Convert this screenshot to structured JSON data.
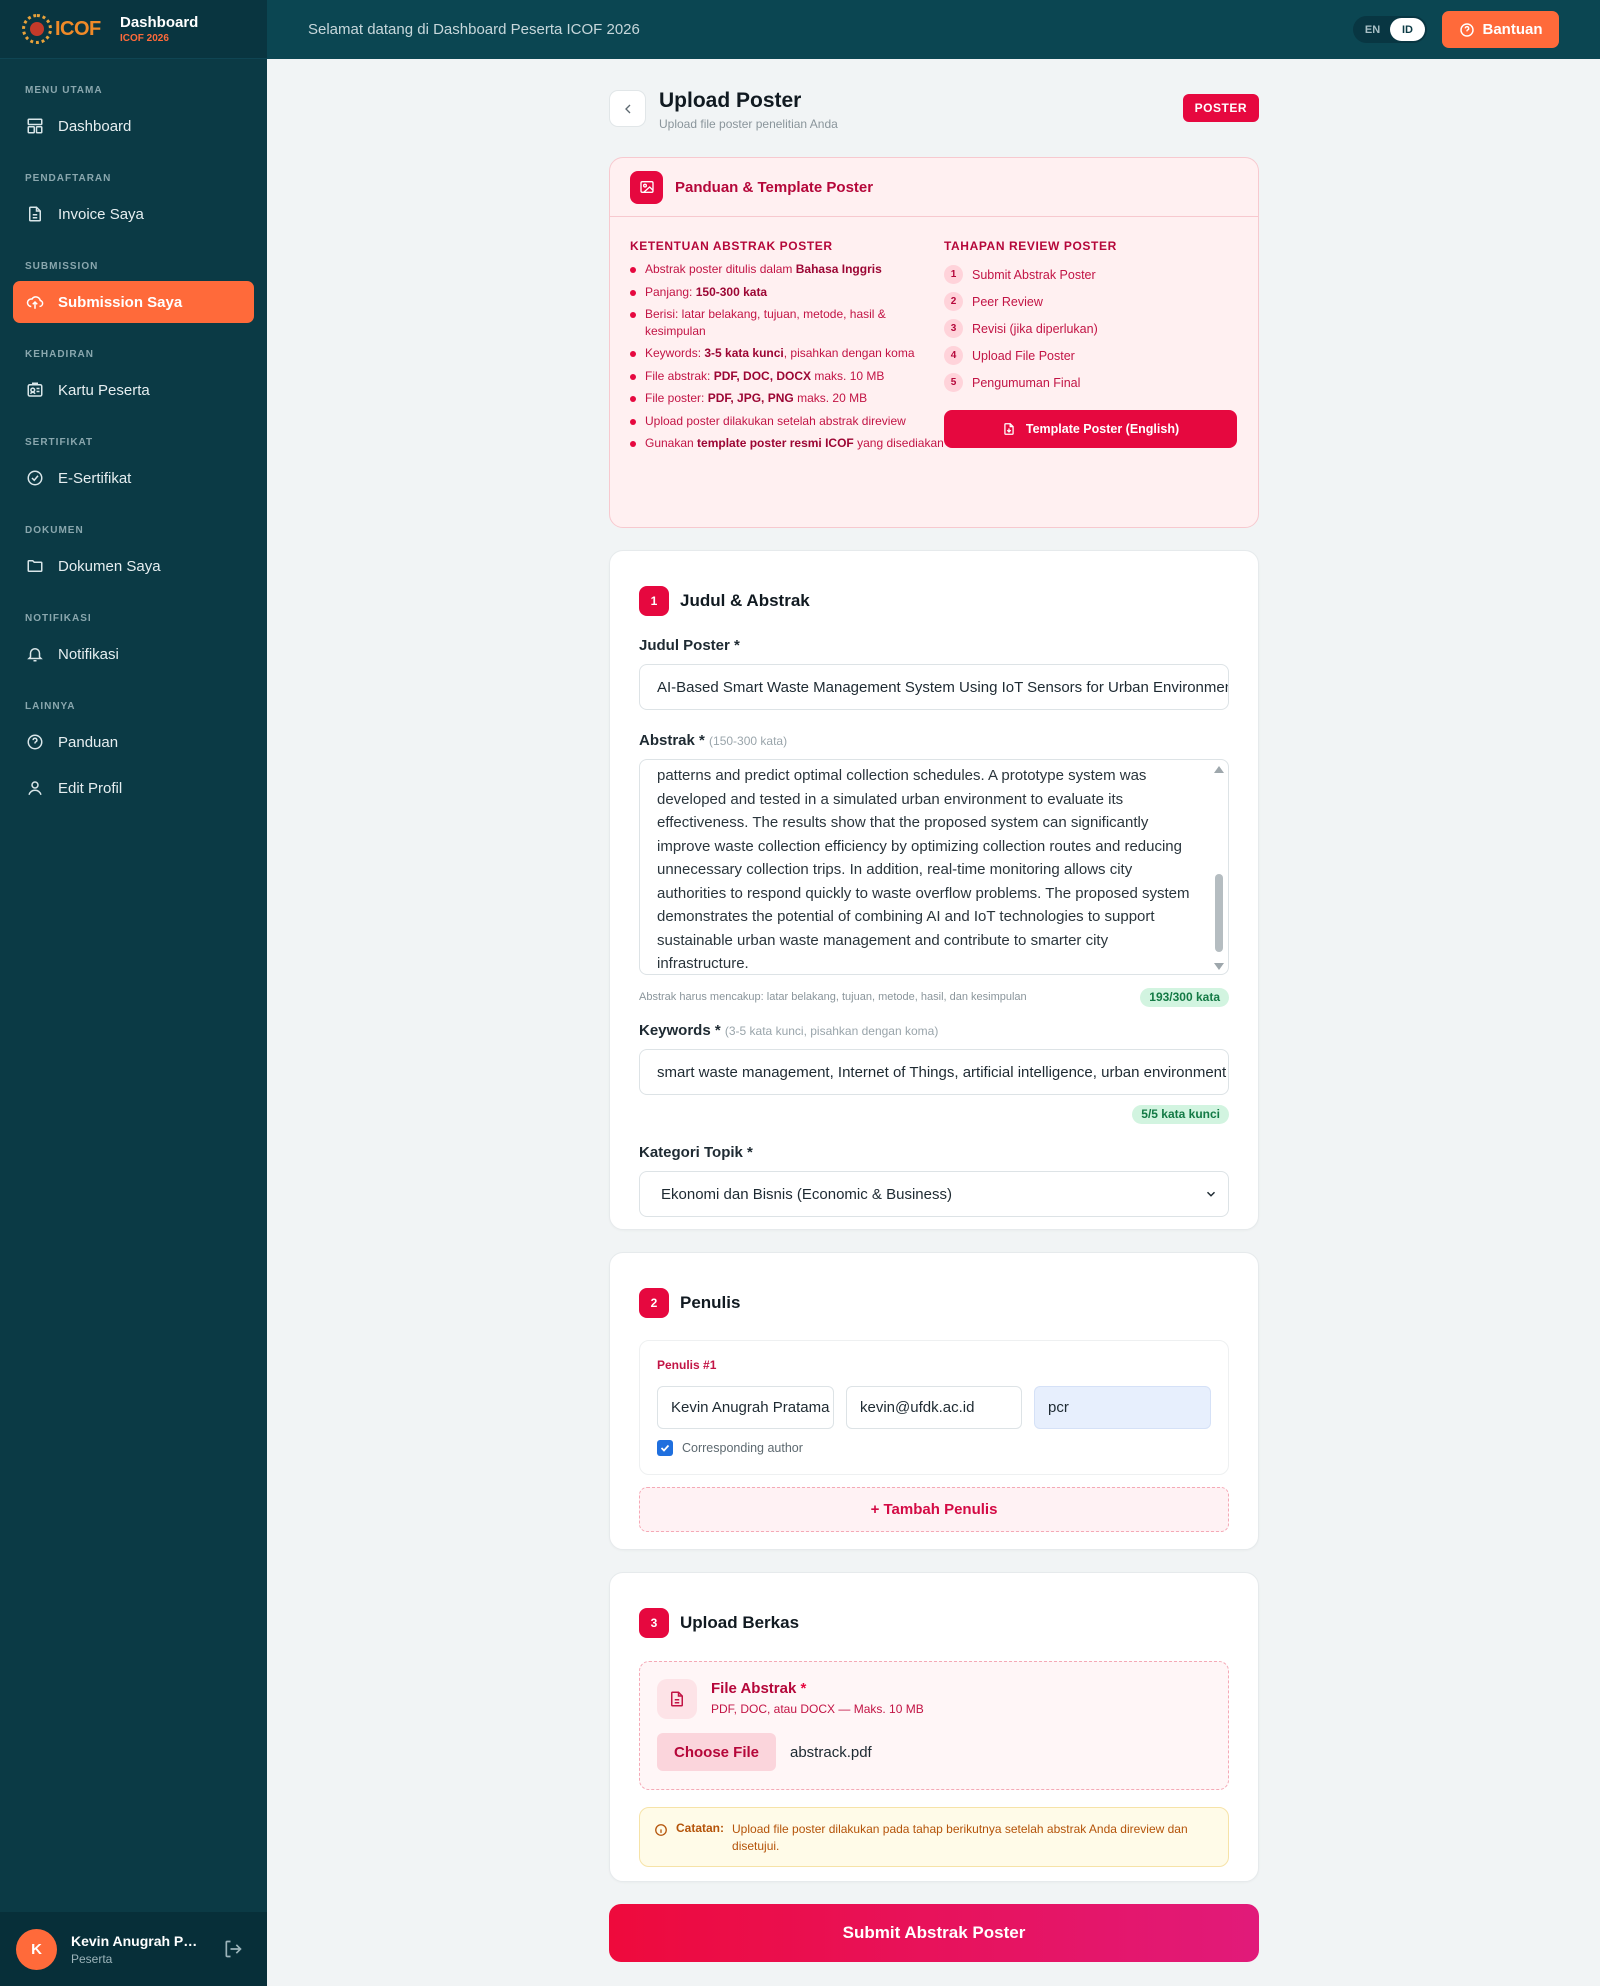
{
  "brand": {
    "logo_text": "ICOF",
    "title": "Dashboard",
    "subtitle": "ICOF 2026"
  },
  "sidebar": {
    "sections": [
      {
        "label": "MENU UTAMA",
        "items": [
          {
            "label": "Dashboard",
            "icon": "dashboard-icon"
          }
        ]
      },
      {
        "label": "PENDAFTARAN",
        "items": [
          {
            "label": "Invoice Saya",
            "icon": "document-icon"
          }
        ]
      },
      {
        "label": "SUBMISSION",
        "items": [
          {
            "label": "Submission Saya",
            "icon": "upload-cloud-icon",
            "active": true
          }
        ]
      },
      {
        "label": "KEHADIRAN",
        "items": [
          {
            "label": "Kartu Peserta",
            "icon": "id-card-icon"
          }
        ]
      },
      {
        "label": "SERTIFIKAT",
        "items": [
          {
            "label": "E-Sertifikat",
            "icon": "check-circle-icon"
          }
        ]
      },
      {
        "label": "DOKUMEN",
        "items": [
          {
            "label": "Dokumen Saya",
            "icon": "folder-icon"
          }
        ]
      },
      {
        "label": "NOTIFIKASI",
        "items": [
          {
            "label": "Notifikasi",
            "icon": "bell-icon"
          }
        ]
      },
      {
        "label": "LAINNYA",
        "items": [
          {
            "label": "Panduan",
            "icon": "help-circle-icon"
          },
          {
            "label": "Edit Profil",
            "icon": "user-icon"
          }
        ]
      }
    ],
    "user": {
      "initial": "K",
      "name": "Kevin Anugrah Pratama",
      "role": "Peserta"
    }
  },
  "topbar": {
    "welcome": "Selamat datang di Dashboard Peserta ICOF 2026",
    "lang_en": "EN",
    "lang_id": "ID",
    "help_label": "Bantuan"
  },
  "page": {
    "title": "Upload Poster",
    "subtitle": "Upload file poster penelitian Anda",
    "badge": "POSTER"
  },
  "guide": {
    "title": "Panduan & Template Poster",
    "left_head": "KETENTUAN ABSTRAK POSTER",
    "right_head": "TAHAPAN REVIEW POSTER",
    "rules": [
      {
        "pre": "Abstrak poster ditulis dalam ",
        "bold": "Bahasa Inggris",
        "post": ""
      },
      {
        "pre": "Panjang: ",
        "bold": "150-300 kata",
        "post": ""
      },
      {
        "pre": "Berisi: latar belakang, tujuan, metode, hasil & kesimpulan",
        "bold": "",
        "post": ""
      },
      {
        "pre": "Keywords: ",
        "bold": "3-5 kata kunci",
        "post": ", pisahkan dengan koma"
      },
      {
        "pre": "File abstrak: ",
        "bold": "PDF, DOC, DOCX",
        "post": " maks. 10 MB"
      },
      {
        "pre": "File poster: ",
        "bold": "PDF, JPG, PNG",
        "post": " maks. 20 MB"
      },
      {
        "pre": "Upload poster dilakukan setelah abstrak direview",
        "bold": "",
        "post": ""
      },
      {
        "pre": "Gunakan ",
        "bold": "template poster resmi ICOF",
        "post": " yang disediakan"
      }
    ],
    "steps": [
      {
        "num": "1",
        "label": "Submit Abstrak Poster"
      },
      {
        "num": "2",
        "label": "Peer Review"
      },
      {
        "num": "3",
        "label": "Revisi (jika diperlukan)"
      },
      {
        "num": "4",
        "label": "Upload File Poster"
      },
      {
        "num": "5",
        "label": "Pengumuman Final"
      }
    ],
    "template_button": "Template Poster (English)"
  },
  "section1": {
    "num": "1",
    "title": "Judul & Abstrak",
    "title_label": "Judul Poster *",
    "title_value": "AI-Based Smart Waste Management System Using IoT Sensors for Urban Environments",
    "abstract_label": "Abstrak *",
    "abstract_hint": "(150-300 kata)",
    "abstract_value": "patterns and predict optimal collection schedules. A prototype system was developed and tested in a simulated urban environment to evaluate its effectiveness. The results show that the proposed system can significantly improve waste collection efficiency by optimizing collection routes and reducing unnecessary collection trips. In addition, real-time monitoring allows city authorities to respond quickly to waste overflow problems. The proposed system demonstrates the potential of combining AI and IoT technologies to support sustainable urban waste management and contribute to smarter city infrastructure.",
    "abstract_meta": "Abstrak harus mencakup: latar belakang, tujuan, metode, hasil, dan kesimpulan",
    "word_count": "193/300 kata",
    "keywords_label": "Keywords *",
    "keywords_hint": "(3-5 kata kunci, pisahkan dengan koma)",
    "keywords_value": "smart waste management, Internet of Things, artificial intelligence, urban environment",
    "keyword_count": "5/5 kata kunci",
    "category_label": "Kategori Topik *",
    "category_value": "Ekonomi dan Bisnis (Economic & Business)"
  },
  "section2": {
    "num": "2",
    "title": "Penulis",
    "author_tag": "Penulis #1",
    "author_name": "Kevin Anugrah Pratama",
    "author_email": "kevin@ufdk.ac.id",
    "author_affiliation": "pcr",
    "corresponding_label": "Corresponding author",
    "add_author": "+ Tambah Penulis"
  },
  "section3": {
    "num": "3",
    "title": "Upload Berkas",
    "file_title": "File Abstrak",
    "file_req": "*",
    "file_desc": "PDF, DOC, atau DOCX — Maks. 10 MB",
    "choose_label": "Choose File",
    "file_name": "abstrack.pdf",
    "note_label": "Catatan:",
    "note_text": "Upload file poster dilakukan pada tahap berikutnya setelah abstrak Anda direview dan disetujui."
  },
  "submit_label": "Submit Abstrak Poster",
  "colors": {
    "sidebar_bg": "#0b3a45",
    "accent_orange": "#ff6a3a",
    "accent_red": "#e6083f"
  }
}
